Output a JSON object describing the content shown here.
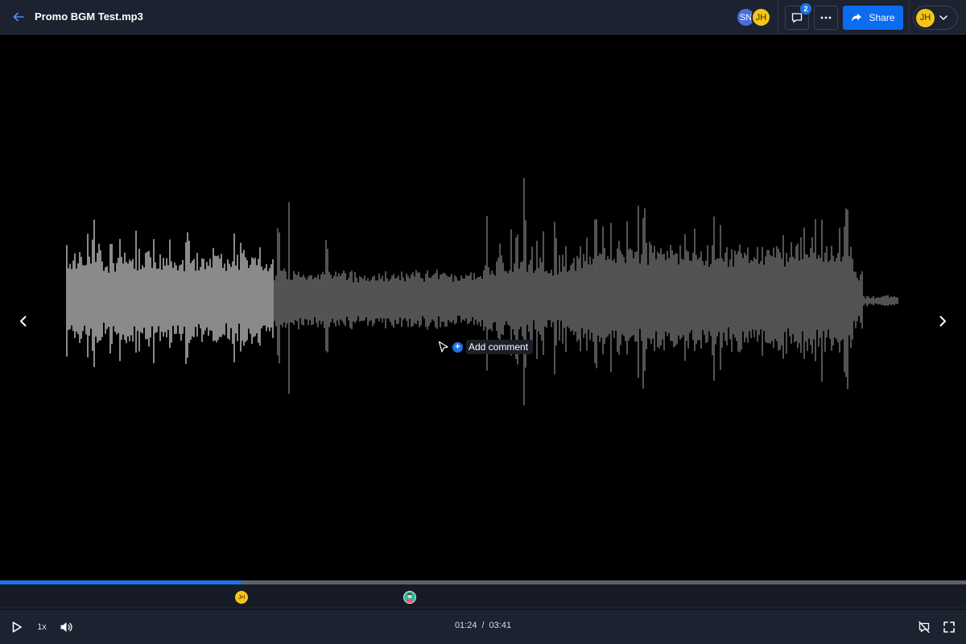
{
  "header": {
    "title": "Promo BGM Test.mp3",
    "collaborators": [
      "SN",
      "JH"
    ],
    "comments_count": "2",
    "share_label": "Share",
    "user_initials": "JH"
  },
  "player": {
    "add_comment_label": "Add comment",
    "add_comment_icon": "+",
    "speed": "1x",
    "current_time": "01:24",
    "separator": "/",
    "duration": "03:41",
    "progress": 0.25
  },
  "markers": [
    {
      "initials": "JH",
      "type": "avatar",
      "position": 0.25
    },
    {
      "initials": "",
      "type": "photo",
      "position": 0.424
    }
  ],
  "colors": {
    "accent": "#1a73e8",
    "header_bg": "#1c2230",
    "waveform_played": "#e6e6e6",
    "waveform_unplayed": "#8a8a8a"
  }
}
